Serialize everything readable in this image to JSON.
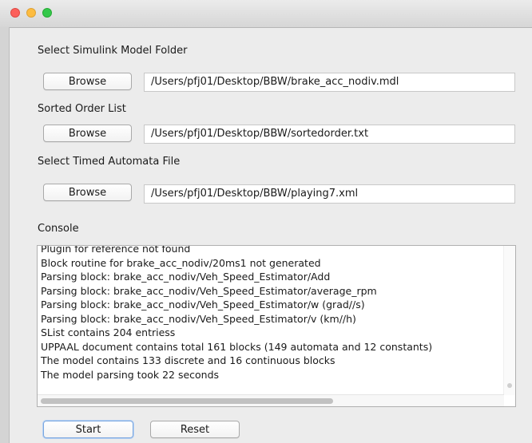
{
  "sections": {
    "model_folder_label": "Select Simulink Model Folder",
    "sorted_order_label": "Sorted Order List",
    "automata_label": "Select Timed Automata File",
    "console_label": "Console"
  },
  "buttons": {
    "browse": "Browse",
    "start": "Start",
    "reset": "Reset"
  },
  "fields": {
    "model_path": "/Users/pfj01/Desktop/BBW/brake_acc_nodiv.mdl",
    "sorted_order_path": "/Users/pfj01/Desktop/BBW/sortedorder.txt",
    "automata_path": "/Users/pfj01/Desktop/BBW/playing7.xml"
  },
  "console": {
    "lines": [
      "Plugin for reference not found",
      "Block routine for brake_acc_nodiv/20ms1 not generated",
      "Parsing block: brake_acc_nodiv/Veh_Speed_Estimator/Add",
      "Parsing block: brake_acc_nodiv/Veh_Speed_Estimator/average_rpm",
      "Parsing block: brake_acc_nodiv/Veh_Speed_Estimator/w (grad//s)",
      "Parsing block: brake_acc_nodiv/Veh_Speed_Estimator/v (km//h)",
      "SList contains 204 entriess",
      "UPPAAL document contains total 161 blocks (149 automata and 12 constants)",
      "The model contains 133 discrete and 16 continuous blocks",
      "The model parsing took 22 seconds"
    ]
  },
  "colors": {
    "close": "#fc605b",
    "minimize": "#fdbc40",
    "zoom": "#34c84a",
    "focus_ring": "#7aa7e0"
  }
}
